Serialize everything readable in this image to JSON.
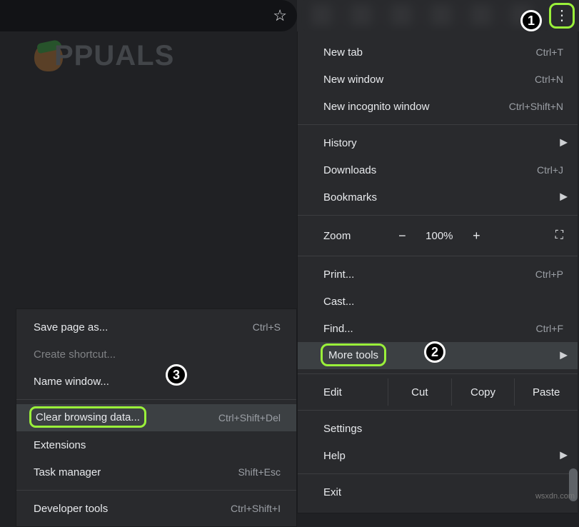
{
  "toolbar": {
    "star_title": "Bookmark this tab"
  },
  "logo_text": "PPUALS",
  "menu": {
    "new_tab": {
      "label": "New tab",
      "shortcut": "Ctrl+T"
    },
    "new_window": {
      "label": "New window",
      "shortcut": "Ctrl+N"
    },
    "incognito": {
      "label": "New incognito window",
      "shortcut": "Ctrl+Shift+N"
    },
    "history": {
      "label": "History"
    },
    "downloads": {
      "label": "Downloads",
      "shortcut": "Ctrl+J"
    },
    "bookmarks": {
      "label": "Bookmarks"
    },
    "zoom_label": "Zoom",
    "zoom_minus": "−",
    "zoom_value": "100%",
    "zoom_plus": "+",
    "print": {
      "label": "Print...",
      "shortcut": "Ctrl+P"
    },
    "cast": {
      "label": "Cast..."
    },
    "find": {
      "label": "Find...",
      "shortcut": "Ctrl+F"
    },
    "more_tools": {
      "label": "More tools"
    },
    "edit_label": "Edit",
    "cut": "Cut",
    "copy": "Copy",
    "paste": "Paste",
    "settings": {
      "label": "Settings"
    },
    "help": {
      "label": "Help"
    },
    "exit": {
      "label": "Exit"
    }
  },
  "submenu": {
    "save_page": {
      "label": "Save page as...",
      "shortcut": "Ctrl+S"
    },
    "create_shortcut": {
      "label": "Create shortcut..."
    },
    "name_window": {
      "label": "Name window..."
    },
    "clear_data": {
      "label": "Clear browsing data...",
      "shortcut": "Ctrl+Shift+Del"
    },
    "extensions": {
      "label": "Extensions"
    },
    "task_manager": {
      "label": "Task manager",
      "shortcut": "Shift+Esc"
    },
    "dev_tools": {
      "label": "Developer tools",
      "shortcut": "Ctrl+Shift+I"
    }
  },
  "annotations": {
    "b1": "1",
    "b2": "2",
    "b3": "3"
  },
  "watermark": "wsxdn.com"
}
